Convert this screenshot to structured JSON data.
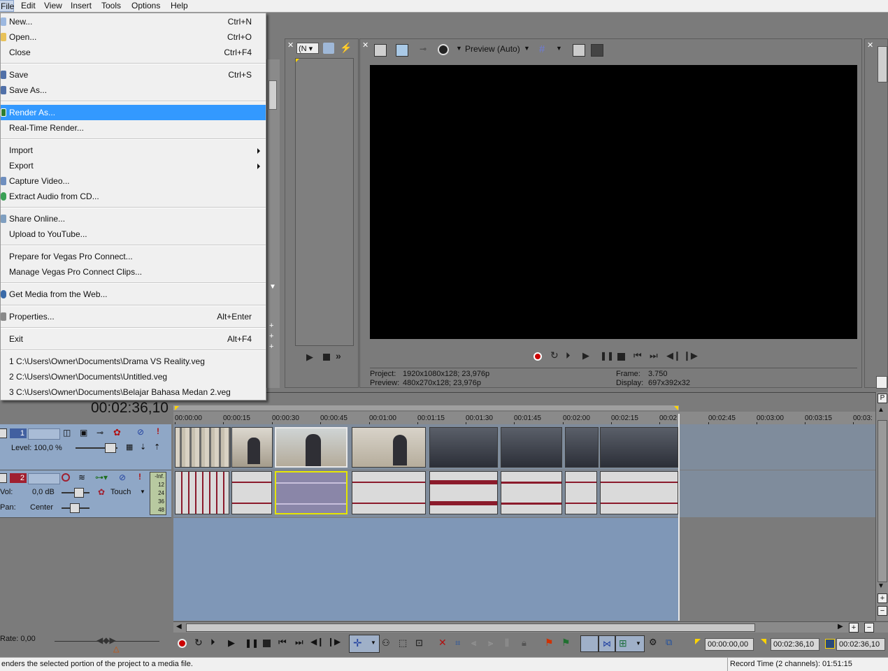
{
  "menubar": [
    "File",
    "Edit",
    "View",
    "Insert",
    "Tools",
    "Options",
    "Help"
  ],
  "file_menu": {
    "new": {
      "label": "New...",
      "shortcut": "Ctrl+N"
    },
    "open": {
      "label": "Open...",
      "shortcut": "Ctrl+O"
    },
    "close": {
      "label": "Close",
      "shortcut": "Ctrl+F4"
    },
    "save": {
      "label": "Save",
      "shortcut": "Ctrl+S"
    },
    "save_as": {
      "label": "Save As..."
    },
    "render_as": {
      "label": "Render As..."
    },
    "realtime_render": {
      "label": "Real-Time Render..."
    },
    "import": {
      "label": "Import"
    },
    "export": {
      "label": "Export"
    },
    "capture_video": {
      "label": "Capture Video..."
    },
    "extract_audio": {
      "label": "Extract Audio from CD..."
    },
    "share_online": {
      "label": "Share Online..."
    },
    "upload_youtube": {
      "label": "Upload to YouTube..."
    },
    "prepare_connect": {
      "label": "Prepare for Vegas Pro Connect..."
    },
    "manage_connect": {
      "label": "Manage Vegas Pro Connect Clips..."
    },
    "get_media": {
      "label": "Get Media from the Web..."
    },
    "properties": {
      "label": "Properties...",
      "shortcut": "Alt+Enter"
    },
    "exit": {
      "label": "Exit",
      "shortcut": "Alt+F4"
    },
    "recent": [
      "1 C:\\Users\\Owner\\Documents\\Drama VS Reality.veg",
      "2 C:\\Users\\Owner\\Documents\\Untitled.veg",
      "3 C:\\Users\\Owner\\Documents\\Belajar Bahasa Medan 2.veg"
    ]
  },
  "trimmer": {
    "dropdown": "(N"
  },
  "preview": {
    "quality": "Preview (Auto)",
    "project_label": "Project:",
    "project_value": "1920x1080x128; 23,976p",
    "preview_label": "Preview:",
    "preview_value": "480x270x128; 23,976p",
    "frame_label": "Frame:",
    "frame_value": "3.750",
    "display_label": "Display:",
    "display_value": "697x392x32"
  },
  "timeline": {
    "timecode": "00:02:36,10",
    "ruler": [
      "00:00:00",
      "00:00:15",
      "00:00:30",
      "00:00:45",
      "00:01:00",
      "00:01:15",
      "00:01:30",
      "00:01:45",
      "00:02:00",
      "00:02:15",
      "00:02",
      "00:02:45",
      "00:03:00",
      "00:03:15",
      "00:03:"
    ],
    "track1": {
      "number": "1",
      "level": "Level: 100,0 %"
    },
    "track2": {
      "number": "2",
      "vol_label": "Vol:",
      "vol_value": "0,0 dB",
      "pan_label": "Pan:",
      "pan_value": "Center",
      "touch": "Touch",
      "meter": [
        "-Inf.",
        "12",
        "24",
        "36",
        "48"
      ]
    },
    "rate": "Rate: 0,00",
    "tc_start": "00:00:00,00",
    "tc_end": "00:02:36,10",
    "tc_length": "00:02:36,10"
  },
  "status": {
    "left": "enders the selected portion of the project to a media file.",
    "right": "Record Time (2 channels): 01:51:15"
  },
  "colors": {
    "highlight": "#3399ff",
    "track_area": "#7f97b7",
    "waveform": "#8b1a2b",
    "menu_bg": "#f0f0f0"
  }
}
